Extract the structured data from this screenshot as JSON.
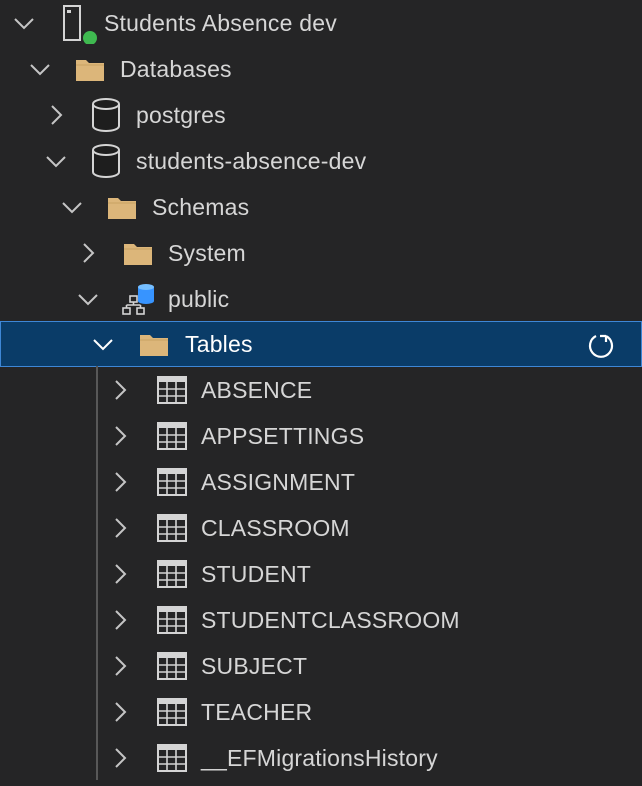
{
  "connection": {
    "label": "Students Absence dev",
    "icon": "server-icon",
    "status_color": "#3fb950"
  },
  "databases_folder": {
    "label": "Databases",
    "icon": "folder-icon"
  },
  "databases": [
    {
      "label": "postgres",
      "icon": "database-icon",
      "expanded": false
    },
    {
      "label": "students-absence-dev",
      "icon": "database-icon",
      "expanded": true
    }
  ],
  "schemas_folder": {
    "label": "Schemas",
    "icon": "folder-icon"
  },
  "schemas": [
    {
      "label": "System",
      "icon": "folder-icon",
      "expanded": false
    },
    {
      "label": "public",
      "icon": "schema-icon",
      "expanded": true
    }
  ],
  "tables_folder": {
    "label": "Tables",
    "icon": "folder-icon",
    "selected": true,
    "action_icon": "refresh-icon"
  },
  "tables": [
    {
      "label": "ABSENCE",
      "icon": "table-icon"
    },
    {
      "label": "APPSETTINGS",
      "icon": "table-icon"
    },
    {
      "label": "ASSIGNMENT",
      "icon": "table-icon"
    },
    {
      "label": "CLASSROOM",
      "icon": "table-icon"
    },
    {
      "label": "STUDENT",
      "icon": "table-icon"
    },
    {
      "label": "STUDENTCLASSROOM",
      "icon": "table-icon"
    },
    {
      "label": "SUBJECT",
      "icon": "table-icon"
    },
    {
      "label": "TEACHER",
      "icon": "table-icon"
    },
    {
      "label": "__EFMigrationsHistory",
      "icon": "table-icon"
    }
  ],
  "colors": {
    "background": "#252526",
    "selection_bg": "#0a3c68",
    "selection_border": "#3e87d6",
    "folder": "#dcb67a",
    "text": "#d6d6d6"
  }
}
